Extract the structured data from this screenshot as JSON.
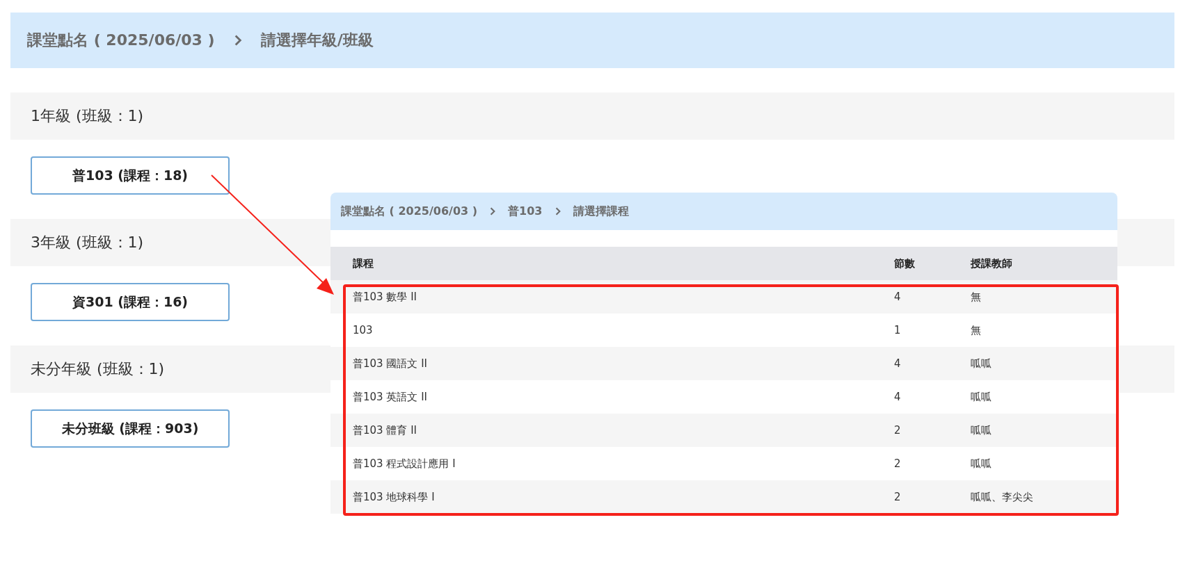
{
  "breadcrumb": [
    "課堂點名 ( 2025/06/03 )",
    "請選擇年級/班級"
  ],
  "grades": [
    {
      "title": "1年級 (班級：1)",
      "classes": [
        "普103 (課程：18)"
      ]
    },
    {
      "title": "3年級 (班級：1)",
      "classes": [
        "資301 (課程：16)"
      ]
    },
    {
      "title": "未分年級 (班級：1)",
      "classes": [
        "未分班級 (課程：903)"
      ]
    }
  ],
  "inset": {
    "breadcrumb": [
      "課堂點名 ( 2025/06/03 )",
      "普103",
      "請選擇課程"
    ],
    "table": {
      "columns": [
        "課程",
        "節數",
        "授課教師"
      ],
      "rows": [
        [
          "普103 數學 II",
          "4",
          "無"
        ],
        [
          "103",
          "1",
          "無"
        ],
        [
          "普103 國語文 II",
          "4",
          "呱呱"
        ],
        [
          "普103 英語文 II",
          "4",
          "呱呱"
        ],
        [
          "普103 體育 II",
          "2",
          "呱呱"
        ],
        [
          "普103 程式設計應用 I",
          "2",
          "呱呱"
        ],
        [
          "普103 地球科學 I",
          "2",
          "呱呱、李尖尖"
        ]
      ]
    }
  }
}
